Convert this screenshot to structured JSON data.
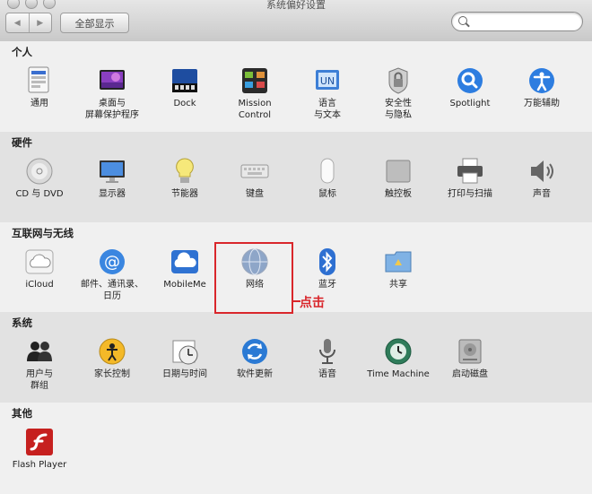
{
  "window": {
    "title": "系统偏好设置",
    "back_label": "◀",
    "forward_label": "▶",
    "show_all": "全部显示",
    "search_value": "",
    "search_placeholder": ""
  },
  "sections": [
    {
      "title": "个人",
      "items": [
        {
          "label": "通用",
          "icon": "general-icon"
        },
        {
          "label": "桌面与\n屏幕保护程序",
          "icon": "desktop-screensaver-icon"
        },
        {
          "label": "Dock",
          "icon": "dock-icon"
        },
        {
          "label": "Mission\nControl",
          "icon": "mission-control-icon"
        },
        {
          "label": "语言\n与文本",
          "icon": "language-text-icon"
        },
        {
          "label": "安全性\n与隐私",
          "icon": "security-privacy-icon"
        },
        {
          "label": "Spotlight",
          "icon": "spotlight-icon"
        },
        {
          "label": "万能辅助",
          "icon": "universal-access-icon"
        }
      ]
    },
    {
      "title": "硬件",
      "items": [
        {
          "label": "CD 与 DVD",
          "icon": "cd-dvd-icon"
        },
        {
          "label": "显示器",
          "icon": "displays-icon"
        },
        {
          "label": "节能器",
          "icon": "energy-saver-icon"
        },
        {
          "label": "键盘",
          "icon": "keyboard-icon"
        },
        {
          "label": "鼠标",
          "icon": "mouse-icon"
        },
        {
          "label": "触控板",
          "icon": "trackpad-icon"
        },
        {
          "label": "打印与扫描",
          "icon": "print-scan-icon"
        },
        {
          "label": "声音",
          "icon": "sound-icon"
        }
      ]
    },
    {
      "title": "互联网与无线",
      "items": [
        {
          "label": "iCloud",
          "icon": "icloud-icon"
        },
        {
          "label": "邮件、通讯录、\n日历",
          "icon": "mail-contacts-calendars-icon"
        },
        {
          "label": "MobileMe",
          "icon": "mobileme-icon"
        },
        {
          "label": "网络",
          "icon": "network-icon"
        },
        {
          "label": "蓝牙",
          "icon": "bluetooth-icon"
        },
        {
          "label": "共享",
          "icon": "sharing-icon"
        }
      ]
    },
    {
      "title": "系统",
      "items": [
        {
          "label": "用户与\n群组",
          "icon": "users-groups-icon"
        },
        {
          "label": "家长控制",
          "icon": "parental-controls-icon"
        },
        {
          "label": "日期与时间",
          "icon": "date-time-icon"
        },
        {
          "label": "软件更新",
          "icon": "software-update-icon"
        },
        {
          "label": "语音",
          "icon": "speech-icon"
        },
        {
          "label": "Time Machine",
          "icon": "time-machine-icon"
        },
        {
          "label": "启动磁盘",
          "icon": "startup-disk-icon"
        }
      ]
    },
    {
      "title": "其他",
      "items": [
        {
          "label": "Flash Player",
          "icon": "flash-player-icon"
        }
      ]
    }
  ],
  "annotation": {
    "text": "点击"
  }
}
